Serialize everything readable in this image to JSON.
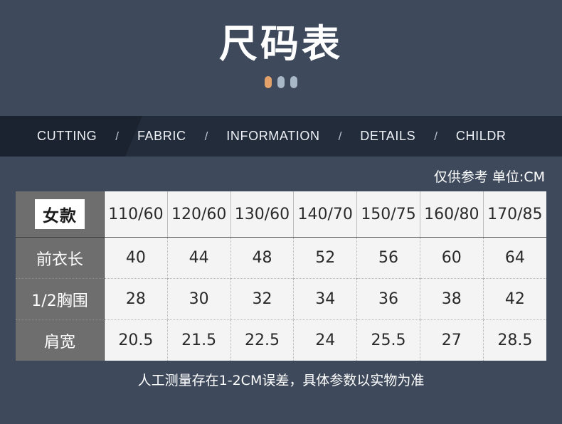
{
  "hero": {
    "title": "尺码表",
    "dots": [
      {
        "name": "dot-active",
        "color": "#e3a26a"
      },
      {
        "name": "dot-2",
        "color": "#a8b8c6"
      },
      {
        "name": "dot-3",
        "color": "#a8b8c6"
      }
    ]
  },
  "nav": {
    "separator": "/",
    "items": [
      {
        "label": "CUTTING"
      },
      {
        "label": "FABRIC"
      },
      {
        "label": "INFORMATION"
      },
      {
        "label": "DETAILS"
      },
      {
        "label": "CHILDR"
      }
    ]
  },
  "unit_note": "仅供参考 单位:CM",
  "table": {
    "corner_label": "女款",
    "columns": [
      "110/60",
      "120/60",
      "130/60",
      "140/70",
      "150/75",
      "160/80",
      "170/85"
    ],
    "rows": [
      {
        "label": "前衣长",
        "values": [
          "40",
          "44",
          "48",
          "52",
          "56",
          "60",
          "64"
        ]
      },
      {
        "label": "1/2胸围",
        "values": [
          "28",
          "30",
          "32",
          "34",
          "36",
          "38",
          "42"
        ]
      },
      {
        "label": "肩宽",
        "values": [
          "20.5",
          "21.5",
          "22.5",
          "24",
          "25.5",
          "27",
          "28.5"
        ]
      }
    ]
  },
  "footer_note": "人工测量存在1-2CM误差，具体参数以实物为准",
  "colors": {
    "page_background": "#3e4a5c",
    "nav_background": "#232c3b",
    "nav_shade": "#1b2330",
    "row_label_background": "#6e6e6e",
    "cell_background": "#f4f4f4",
    "accent_dot": "#e3a26a"
  }
}
